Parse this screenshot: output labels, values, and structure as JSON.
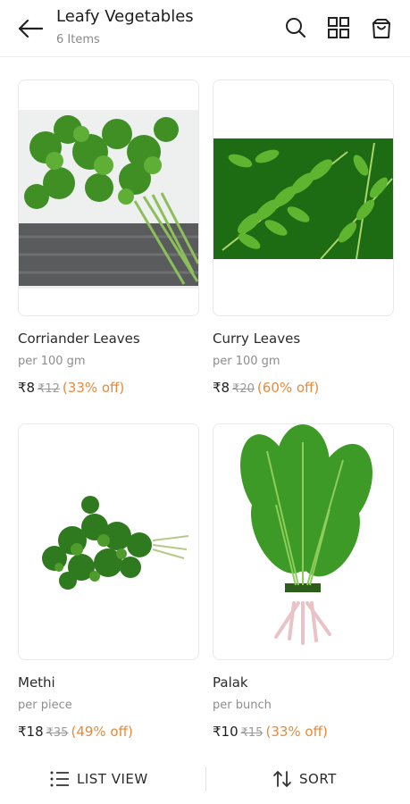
{
  "header": {
    "title": "Leafy Vegetables",
    "subtitle": "6 Items",
    "icons": [
      "back-arrow-icon",
      "search-icon",
      "grid-view-icon",
      "cart-icon"
    ]
  },
  "products": [
    {
      "name": "Corriander Leaves",
      "unit": "per 100 gm",
      "price": "₹8",
      "mrp": "₹12",
      "discount": "(33% off)"
    },
    {
      "name": "Curry Leaves",
      "unit": "per 100 gm",
      "price": "₹8",
      "mrp": "₹20",
      "discount": "(60% off)"
    },
    {
      "name": "Methi",
      "unit": "per piece",
      "price": "₹18",
      "mrp": "₹35",
      "discount": "(49% off)"
    },
    {
      "name": "Palak",
      "unit": "per bunch",
      "price": "₹10",
      "mrp": "₹15",
      "discount": "(33% off)"
    }
  ],
  "bottom_bar": {
    "list_view_label": "LIST VIEW",
    "sort_label": "SORT"
  },
  "colors": {
    "discount": "#e58a3c",
    "leaf_dark": "#2f7a1f",
    "leaf_light": "#5fae36"
  }
}
